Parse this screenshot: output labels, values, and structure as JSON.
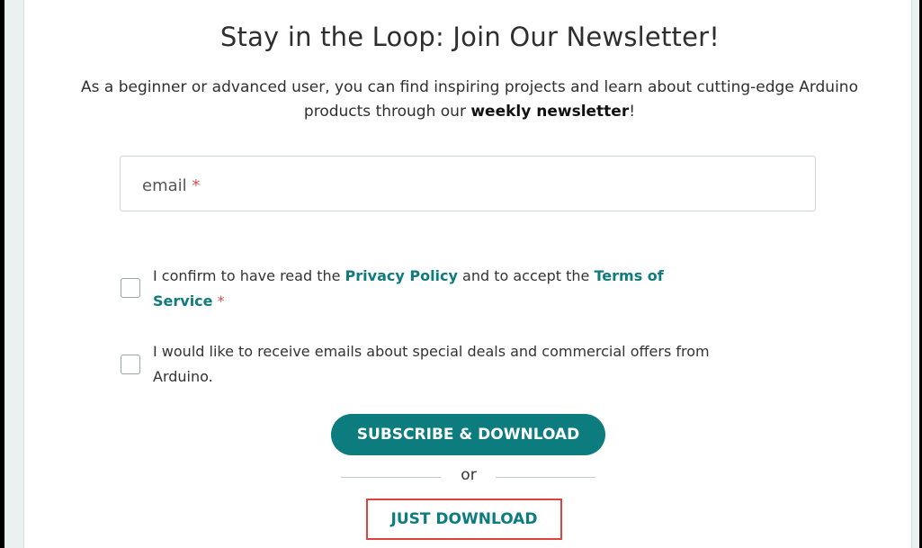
{
  "newsletter": {
    "title": "Stay in the Loop: Join Our Newsletter!",
    "subtitle_part1": "As a beginner or advanced user, you can find inspiring projects and learn about cutting-edge Arduino products through our ",
    "subtitle_bold": "weekly newsletter",
    "subtitle_end": "!",
    "email_placeholder": "email",
    "required_marker": "*",
    "consent": {
      "text1": "I confirm to have read the ",
      "privacy_link": "Privacy Policy",
      "text2": " and to accept the ",
      "terms_link": "Terms of Service",
      "required_marker": "*"
    },
    "offers": {
      "text": "I would like to receive emails about special deals and commercial offers from Arduino."
    },
    "subscribe_button": "SUBSCRIBE & DOWNLOAD",
    "or_text": "or",
    "just_download_button": "JUST DOWNLOAD"
  },
  "colors": {
    "accent": "#0c7c7e",
    "required": "#d05151",
    "highlight_box": "#e04040"
  }
}
